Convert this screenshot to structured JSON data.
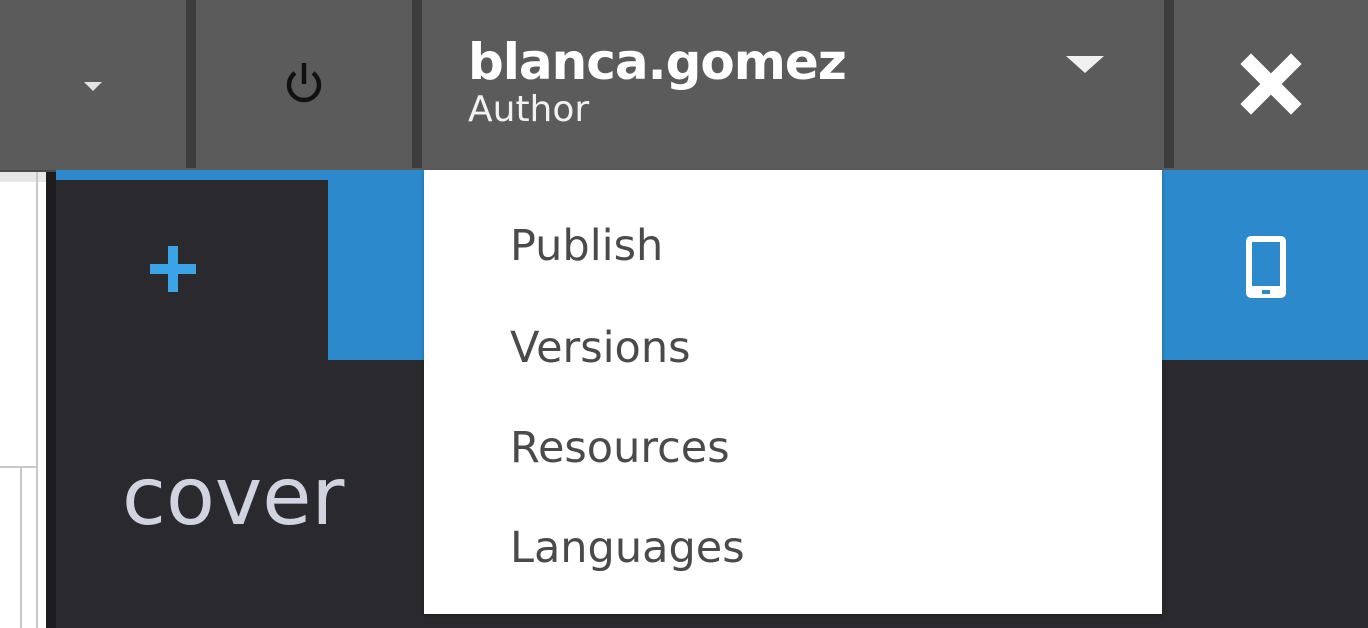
{
  "topbar": {
    "dropdown_icon": "caret-down-icon",
    "power_icon": "power-icon",
    "user": {
      "name": "blanca.gomez",
      "role": "Author",
      "menu_icon": "caret-down-icon"
    },
    "close_icon": "close-icon"
  },
  "user_menu": {
    "items": [
      {
        "label": "Publish"
      },
      {
        "label": "Versions"
      },
      {
        "label": "Resources"
      },
      {
        "label": "Languages"
      }
    ]
  },
  "editor": {
    "add_icon": "plus-icon",
    "page_label": "cover",
    "device_icon": "mobile-icon"
  },
  "colors": {
    "topbar": "#5b5b5b",
    "accent_blue": "#2b89cc",
    "panel_dark": "#2a2a2e",
    "menu_text": "#4a4a4a"
  }
}
